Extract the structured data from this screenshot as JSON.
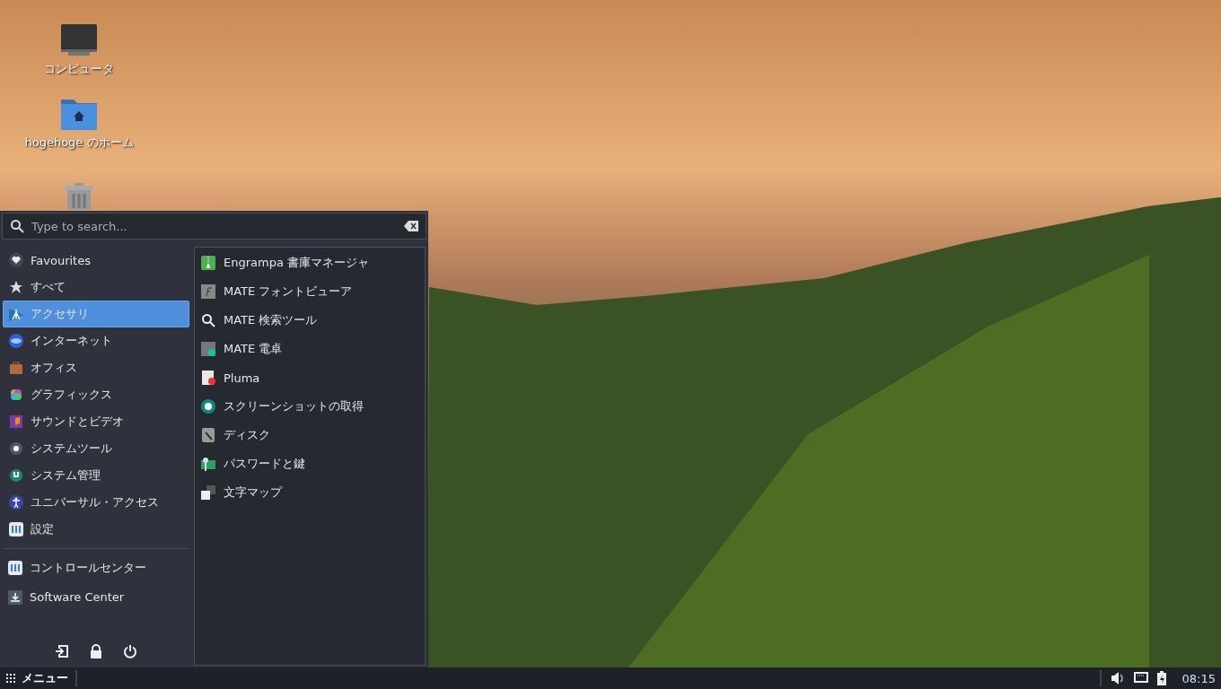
{
  "desktop": {
    "icons": [
      {
        "label": "コンピュータ"
      },
      {
        "label": "hogehoge のホーム"
      }
    ]
  },
  "menu": {
    "search": {
      "placeholder": "Type to search..."
    },
    "categories": [
      {
        "label": "Favourites",
        "selected": false
      },
      {
        "label": "すべて",
        "selected": false
      },
      {
        "label": "アクセサリ",
        "selected": true
      },
      {
        "label": "インターネット",
        "selected": false
      },
      {
        "label": "オフィス",
        "selected": false
      },
      {
        "label": "グラフィックス",
        "selected": false
      },
      {
        "label": "サウンドとビデオ",
        "selected": false
      },
      {
        "label": "システムツール",
        "selected": false
      },
      {
        "label": "システム管理",
        "selected": false
      },
      {
        "label": "ユニバーサル・アクセス",
        "selected": false
      },
      {
        "label": "設定",
        "selected": false
      }
    ],
    "system_items": [
      "コントロールセンター",
      "Software Center"
    ],
    "apps": [
      "Engrampa 書庫マネージャ",
      "MATE フォントビューア",
      "MATE 検索ツール",
      "MATE 電卓",
      "Pluma",
      "スクリーンショットの取得",
      "ディスク",
      "パスワードと鍵",
      "文字マップ"
    ]
  },
  "taskbar": {
    "menu_label": "メニュー",
    "clock": "08:15"
  }
}
